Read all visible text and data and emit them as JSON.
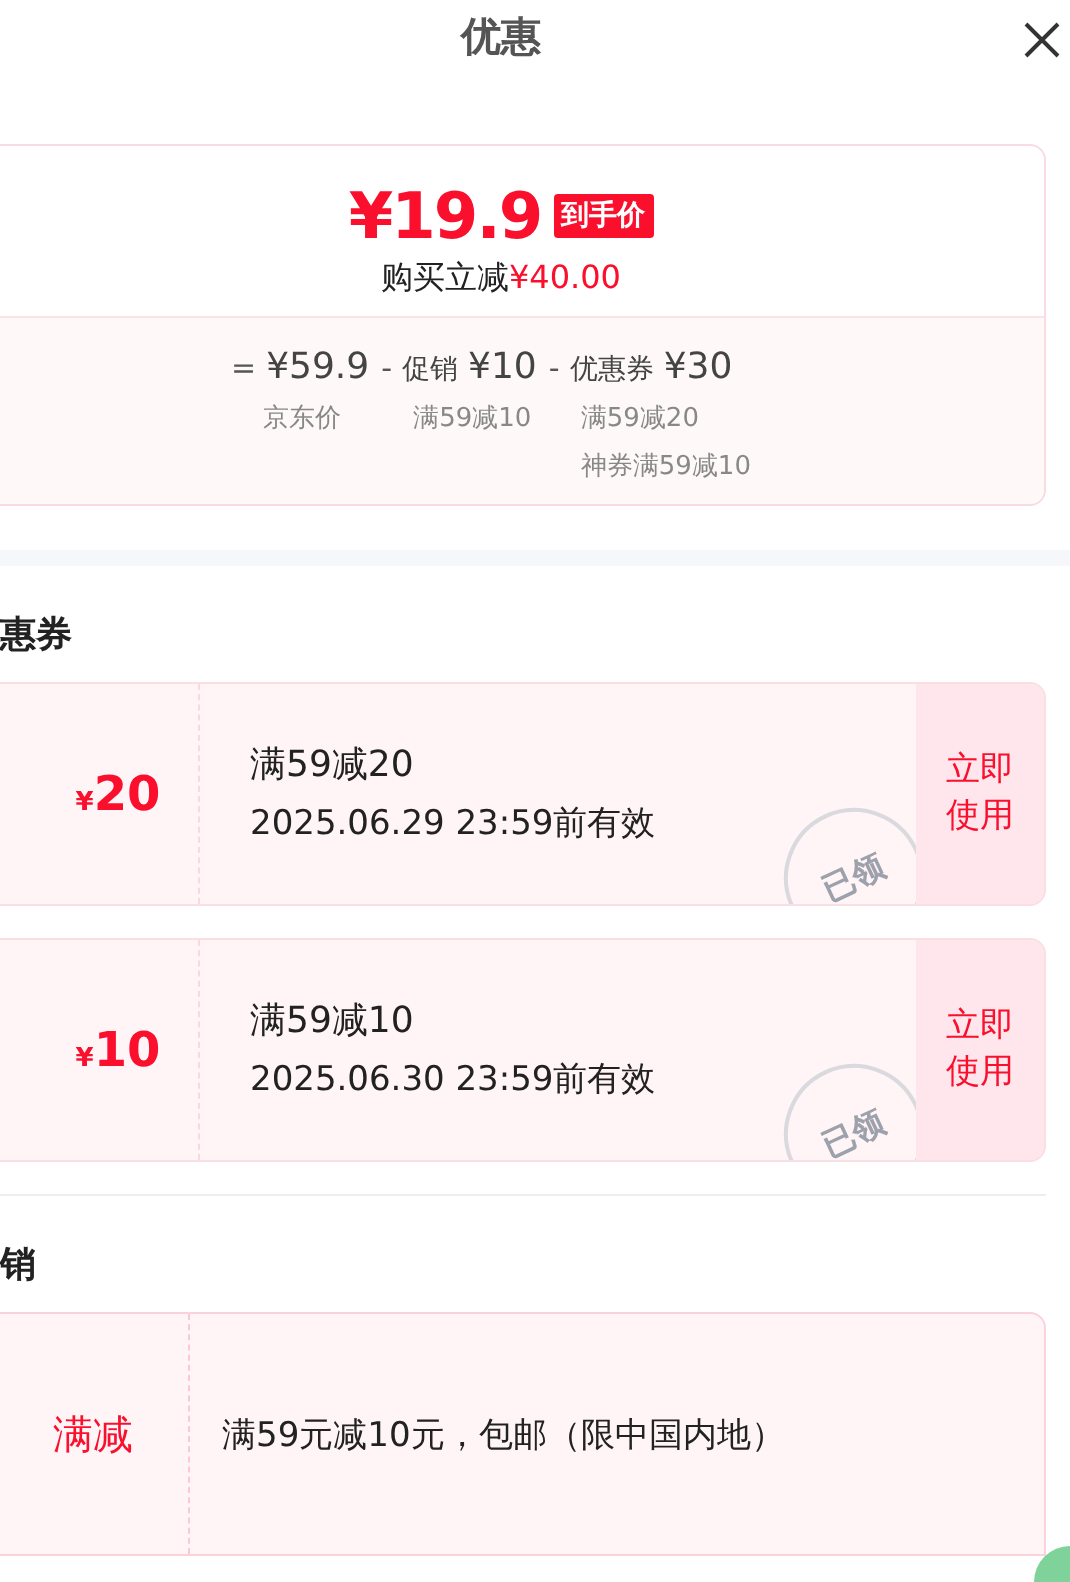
{
  "header": {
    "title": "优惠"
  },
  "summary": {
    "price": "¥19.9",
    "price_tag": "到手价",
    "saving_label": "购买立减",
    "saving_amount": "¥40.00",
    "breakdown": [
      {
        "op": "=",
        "amount": "¥59.9",
        "notes": [
          "京东价"
        ]
      },
      {
        "op": "-",
        "label": "促销",
        "amount": "¥10",
        "notes": [
          "满59减10"
        ]
      },
      {
        "op": "-",
        "label": "优惠券",
        "amount": "¥30",
        "notes": [
          "满59减20",
          "神券满59减10"
        ]
      }
    ]
  },
  "coupon_section": {
    "title": "惠券",
    "coupons": [
      {
        "symbol": "¥",
        "amount": "20",
        "condition": "满59减20",
        "validity": "2025.06.29 23:59前有效",
        "stamp": "已领",
        "action": "立即使用"
      },
      {
        "symbol": "¥",
        "amount": "10",
        "condition": "满59减10",
        "validity": "2025.06.30 23:59前有效",
        "stamp": "已领",
        "action": "立即使用"
      }
    ]
  },
  "promo_section": {
    "title": "销",
    "promos": [
      {
        "tag": "满减",
        "text": "满59元减10元，包邮（限中国内地）"
      }
    ]
  }
}
